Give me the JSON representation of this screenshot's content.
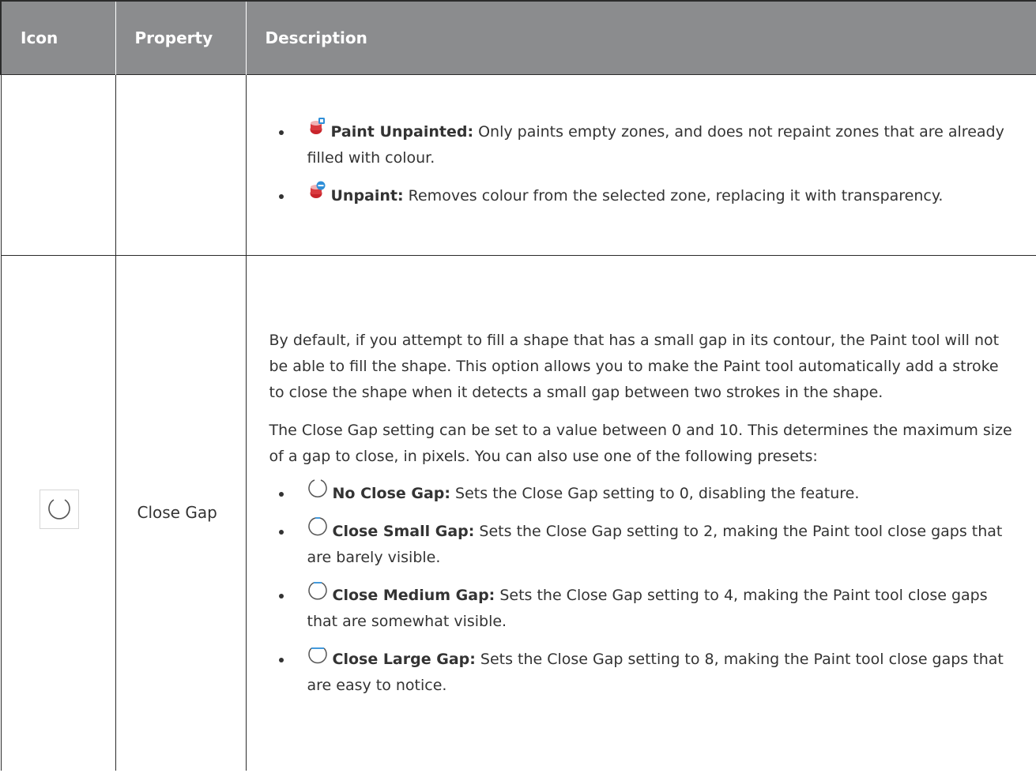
{
  "table": {
    "headers": [
      "Icon",
      "Property",
      "Description"
    ],
    "row1": {
      "icon": "",
      "property": "",
      "items": [
        {
          "icon_name": "paint-unpainted-icon",
          "label": "Paint Unpainted:",
          "text": " Only paints empty zones, and does not repaint zones that are already filled with colour."
        },
        {
          "icon_name": "unpaint-icon",
          "label": "Unpaint:",
          "text": " Removes colour from the selected zone, replacing it with transparency."
        }
      ]
    },
    "row2": {
      "icon_name": "no-close-gap-icon",
      "property": "Close Gap",
      "paragraphs": [
        "By default, if you attempt to fill a shape that has a small gap in its contour, the Paint tool will not be able to fill the shape. This option allows you to make the Paint tool automatically add a stroke to close the shape when it detects a small gap between two strokes in the shape.",
        "The Close Gap setting can be set to a value between 0 and 10. This determines the maximum size of a gap to close, in pixels. You can also use one of the following presets:"
      ],
      "presets": [
        {
          "icon_name": "no-close-gap-icon",
          "label": "No Close Gap:",
          "text": " Sets the Close Gap setting to 0, disabling the feature."
        },
        {
          "icon_name": "close-small-gap-icon",
          "label": "Close Small Gap:",
          "text": " Sets the Close Gap setting to 2, making the Paint tool close gaps that are barely visible."
        },
        {
          "icon_name": "close-medium-gap-icon",
          "label": "Close Medium Gap:",
          "text": " Sets the Close Gap setting to 4, making the Paint tool close gaps that are somewhat visible."
        },
        {
          "icon_name": "close-large-gap-icon",
          "label": "Close Large Gap:",
          "text": " Sets the Close Gap setting to 8, making the Paint tool close gaps that are easy to notice."
        }
      ]
    }
  },
  "colors": {
    "header_bg": "#8b8c8e",
    "header_text": "#ffffff",
    "border": "#2b2b2b",
    "body_text": "#333333",
    "paint_red": "#c8242b",
    "paint_blue": "#2f8fd8"
  }
}
